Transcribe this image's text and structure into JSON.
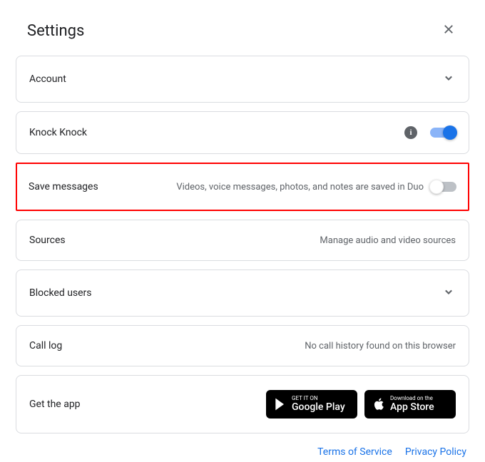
{
  "header": {
    "title": "Settings"
  },
  "rows": {
    "account": {
      "label": "Account"
    },
    "knock": {
      "label": "Knock Knock"
    },
    "save": {
      "label": "Save messages",
      "desc": "Videos, voice messages, photos, and notes are saved in Duo"
    },
    "sources": {
      "label": "Sources",
      "desc": "Manage audio and video sources"
    },
    "blocked": {
      "label": "Blocked users"
    },
    "calllog": {
      "label": "Call log",
      "desc": "No call history found on this browser"
    },
    "getapp": {
      "label": "Get the app"
    }
  },
  "store": {
    "google": {
      "small": "GET IT ON",
      "big": "Google Play"
    },
    "apple": {
      "small": "Download on the",
      "big": "App Store"
    }
  },
  "footer": {
    "terms": "Terms of Service",
    "privacy": "Privacy Policy"
  },
  "info_glyph": "i"
}
